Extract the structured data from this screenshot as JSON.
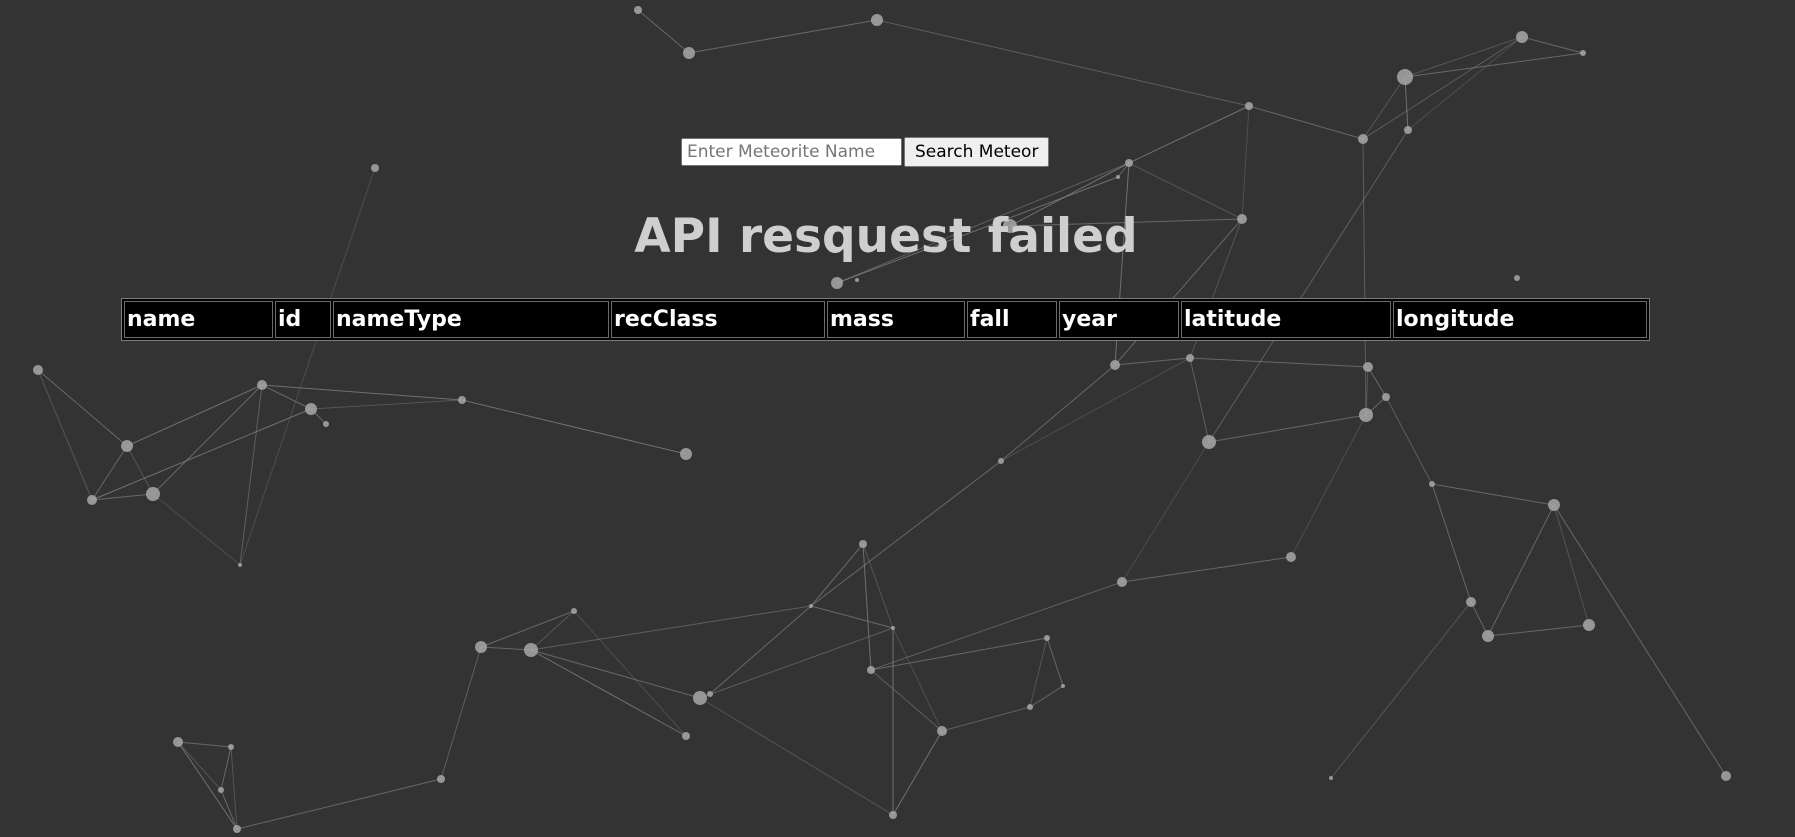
{
  "search": {
    "placeholder": "Enter Meteorite Name",
    "value": "",
    "button_label": "Search Meteor"
  },
  "status": {
    "message": "API resquest failed"
  },
  "table": {
    "columns": [
      "name",
      "id",
      "nameType",
      "recClass",
      "mass",
      "fall",
      "year",
      "latitude",
      "longitude"
    ],
    "rows": []
  }
}
